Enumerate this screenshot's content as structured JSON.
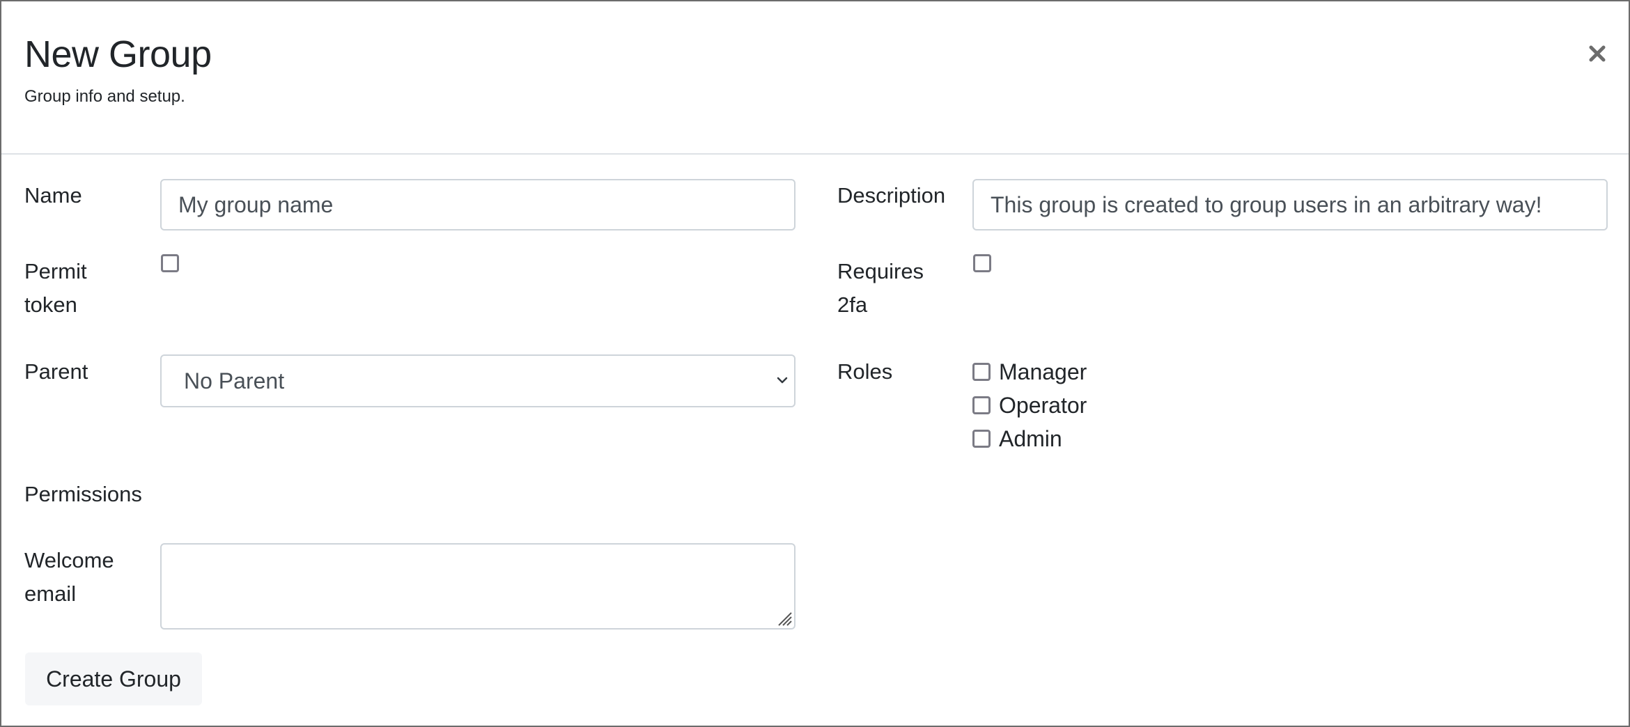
{
  "dialog": {
    "title": "New Group",
    "subtitle": "Group info and setup.",
    "close_icon": "close-icon"
  },
  "form": {
    "name": {
      "label": "Name",
      "placeholder": "My group name",
      "value": ""
    },
    "description": {
      "label": "Description",
      "placeholder": "This group is created to group users in an arbitrary way!",
      "value": ""
    },
    "permit_token": {
      "label_line1": "Permit",
      "label_line2": "token",
      "checked": false
    },
    "requires_2fa": {
      "label_line1": "Requires",
      "label_line2": "2fa",
      "checked": false
    },
    "parent": {
      "label": "Parent",
      "selected": "No Parent"
    },
    "roles": {
      "label": "Roles",
      "options": [
        {
          "label": "Manager",
          "checked": false
        },
        {
          "label": "Operator",
          "checked": false
        },
        {
          "label": "Admin",
          "checked": false
        }
      ]
    },
    "permissions": {
      "label": "Permissions"
    },
    "welcome_email": {
      "label_line1": "Welcome",
      "label_line2": "email",
      "value": ""
    },
    "submit_label": "Create Group"
  }
}
